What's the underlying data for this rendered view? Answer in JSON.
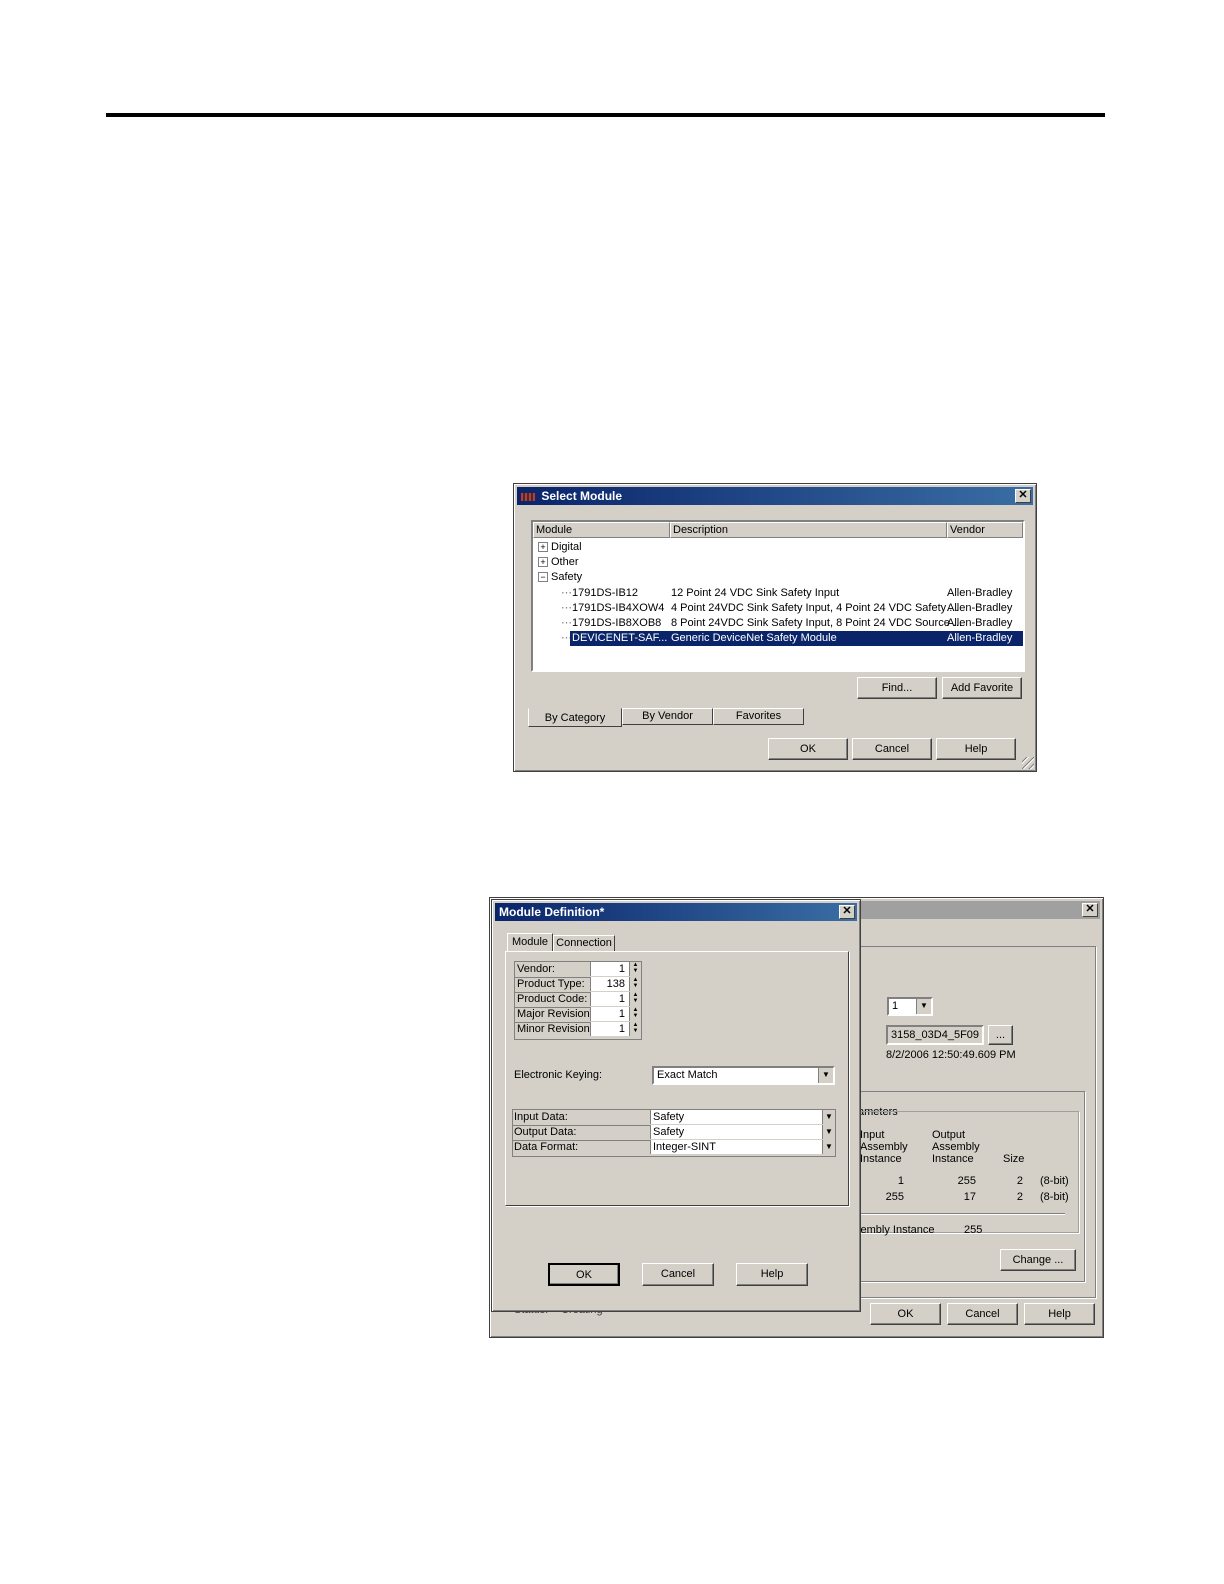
{
  "select_module": {
    "title": "Select Module",
    "columns": [
      "Module",
      "Description",
      "Vendor"
    ],
    "tree": [
      {
        "expander": "+",
        "label": "Digital"
      },
      {
        "expander": "+",
        "label": "Other"
      },
      {
        "expander": "−",
        "label": "Safety"
      }
    ],
    "rows": [
      {
        "module": "1791DS-IB12",
        "description": "12 Point 24 VDC Sink Safety Input",
        "vendor": "Allen-Bradley"
      },
      {
        "module": "1791DS-IB4XOW4",
        "description": "4 Point 24VDC Sink Safety Input, 4 Point 24 VDC Safety ...",
        "vendor": "Allen-Bradley"
      },
      {
        "module": "1791DS-IB8XOB8",
        "description": "8 Point 24VDC Sink Safety Input, 8 Point 24 VDC Source ...",
        "vendor": "Allen-Bradley"
      },
      {
        "module": "DEVICENET-SAF...",
        "description": "Generic DeviceNet Safety Module",
        "vendor": "Allen-Bradley"
      }
    ],
    "find_button": "Find...",
    "add_favorite_button": "Add Favorite",
    "tabs": [
      "By Category",
      "By Vendor",
      "Favorites"
    ],
    "ok": "OK",
    "cancel": "Cancel",
    "help": "Help"
  },
  "background_dialog": {
    "node_value": "1",
    "safety_network_number": "3158_03D4_5F09",
    "browse_button": "...",
    "timestamp": "8/2/2006 12:50:49.609 PM",
    "group_title": "ameters",
    "col_input": "Input\nAssembly\nInstance",
    "col_output": "Output\nAssembly\nInstance",
    "col_size": "Size",
    "rows": [
      {
        "input": "1",
        "output": "255",
        "size": "2",
        "unit": "(8-bit)"
      },
      {
        "input": "255",
        "output": "17",
        "size": "2",
        "unit": "(8-bit)"
      }
    ],
    "config_label": "sembly Instance",
    "config_value": "255",
    "change_button": "Change ...",
    "status_label": "Status:",
    "status_value": "Creating",
    "ok": "OK",
    "cancel": "Cancel",
    "help": "Help"
  },
  "module_definition": {
    "title": "Module Definition*",
    "tabs": [
      "Module",
      "Connection"
    ],
    "fields": [
      {
        "label": "Vendor:",
        "value": "1"
      },
      {
        "label": "Product Type:",
        "value": "138"
      },
      {
        "label": "Product Code:",
        "value": "1"
      },
      {
        "label": "Major Revision:",
        "value": "1"
      },
      {
        "label": "Minor Revision",
        "value": "1"
      }
    ],
    "keying_label": "Electronic Keying:",
    "keying_value": "Exact Match",
    "data_rows": [
      {
        "label": "Input Data:",
        "value": "Safety"
      },
      {
        "label": "Output Data:",
        "value": "Safety"
      },
      {
        "label": "Data Format:",
        "value": "Integer-SINT"
      }
    ],
    "ok": "OK",
    "cancel": "Cancel",
    "help": "Help"
  }
}
